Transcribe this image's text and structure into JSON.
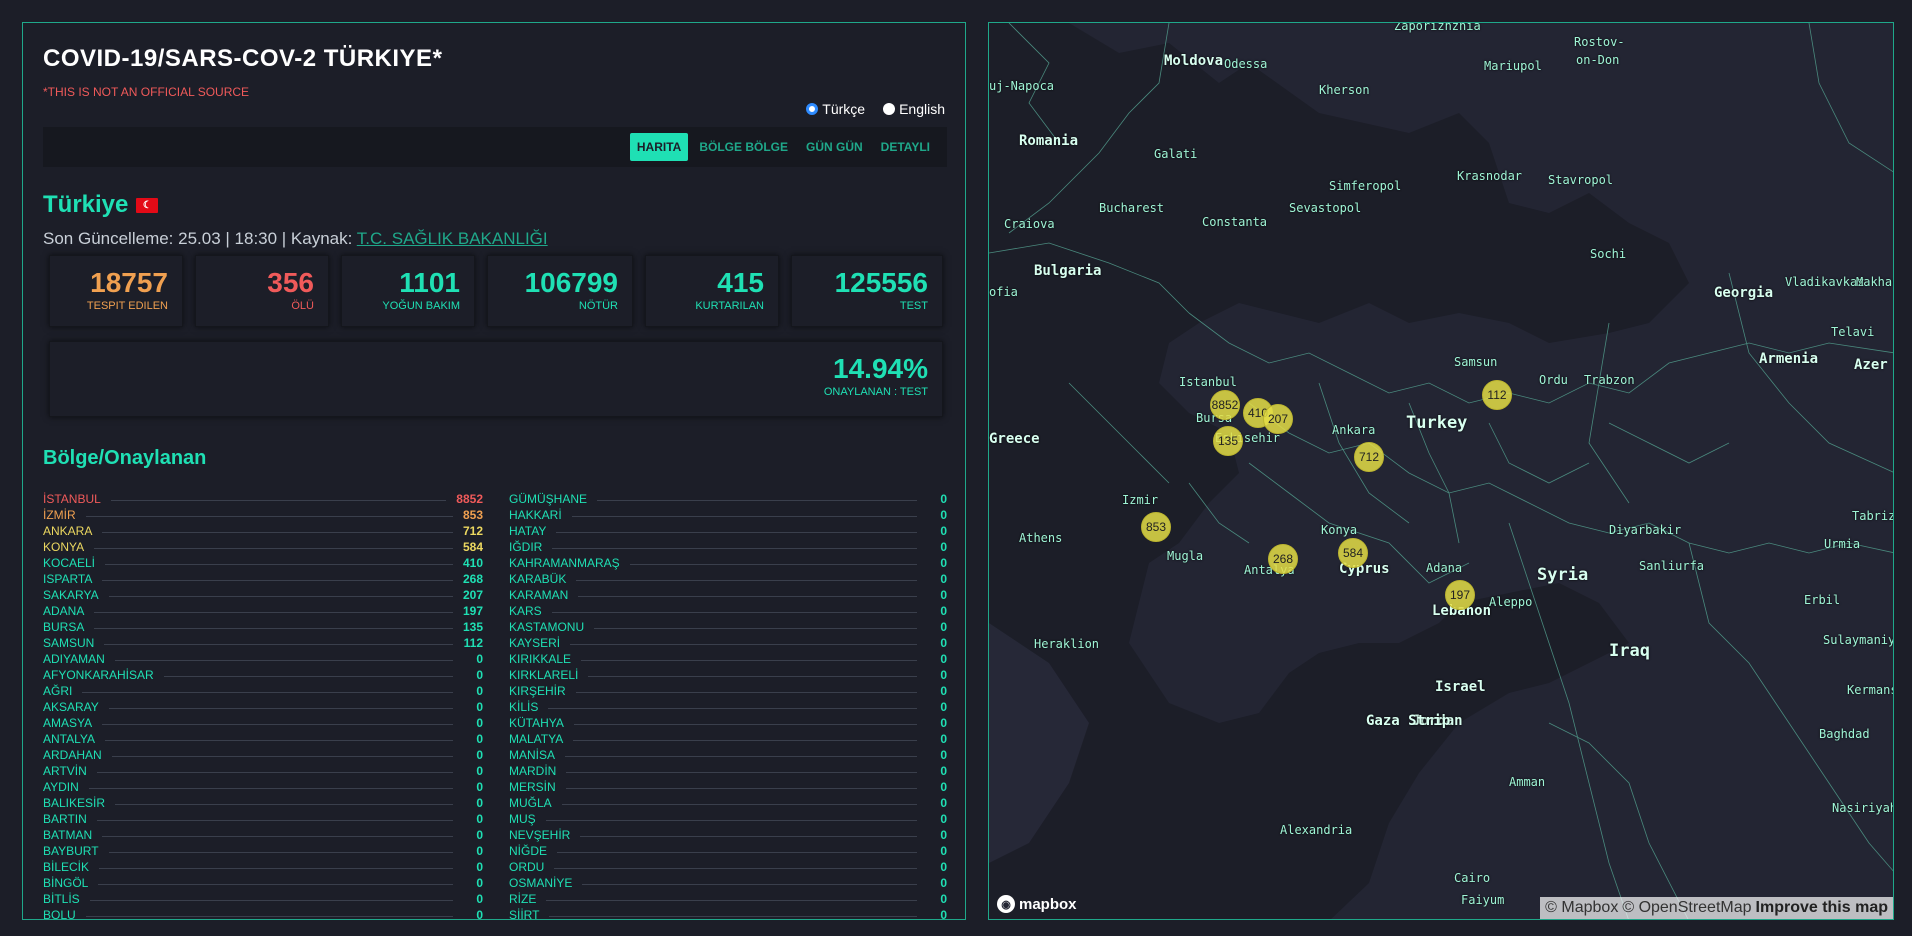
{
  "header": {
    "title": "COVID-19/SARS-COV-2 TÜRKIYE*",
    "disclaimer": "*THIS IS NOT AN OFFICIAL SOURCE"
  },
  "language": {
    "options": [
      {
        "label": "Türkçe",
        "checked": true
      },
      {
        "label": "English",
        "checked": false
      }
    ]
  },
  "tabs": [
    {
      "label": "HARITA",
      "active": true
    },
    {
      "label": "BÖLGE BÖLGE",
      "active": false
    },
    {
      "label": "GÜN GÜN",
      "active": false
    },
    {
      "label": "DETAYLI",
      "active": false
    }
  ],
  "country": {
    "name": "Türkiye",
    "flag_icon": "turkey-flag-icon",
    "updated_prefix": "Son Güncelleme: 25.03 | 18:30 | Kaynak: ",
    "source_link": "T.C. SAĞLIK BAKANLIĞI"
  },
  "stats": [
    {
      "value": "18757",
      "label": "TESPIT EDILEN",
      "color": "#f0a050"
    },
    {
      "value": "356",
      "label": "ÖLÜ",
      "color": "#f05a5a"
    },
    {
      "value": "1101",
      "label": "YOĞUN BAKIM",
      "color": "#1fe0b4"
    },
    {
      "value": "106799",
      "label": "NÖTÜR",
      "color": "#1fe0b4"
    },
    {
      "value": "415",
      "label": "KURTARILAN",
      "color": "#1fe0b4"
    },
    {
      "value": "125556",
      "label": "TEST",
      "color": "#1fe0b4"
    }
  ],
  "ratio": {
    "value": "14.94%",
    "label": "ONAYLANAN : TEST"
  },
  "regions": {
    "title": "Bölge/Onaylanan",
    "left": [
      {
        "name": "İSTANBUL",
        "value": "8852",
        "color": "#f05a5a"
      },
      {
        "name": "İZMİR",
        "value": "853",
        "color": "#f0a050"
      },
      {
        "name": "ANKARA",
        "value": "712",
        "color": "#ecd860"
      },
      {
        "name": "KONYA",
        "value": "584",
        "color": "#ecd860"
      },
      {
        "name": "KOCAELİ",
        "value": "410",
        "color": "#1fe0b4"
      },
      {
        "name": "ISPARTA",
        "value": "268",
        "color": "#1fe0b4"
      },
      {
        "name": "SAKARYA",
        "value": "207",
        "color": "#1fe0b4"
      },
      {
        "name": "ADANA",
        "value": "197",
        "color": "#1fe0b4"
      },
      {
        "name": "BURSA",
        "value": "135",
        "color": "#1fe0b4"
      },
      {
        "name": "SAMSUN",
        "value": "112",
        "color": "#1fe0b4"
      },
      {
        "name": "ADIYAMAN",
        "value": "0",
        "color": "#1fe0b4"
      },
      {
        "name": "AFYONKARAHİSAR",
        "value": "0",
        "color": "#1fe0b4"
      },
      {
        "name": "AĞRI",
        "value": "0",
        "color": "#1fe0b4"
      },
      {
        "name": "AKSARAY",
        "value": "0",
        "color": "#1fe0b4"
      },
      {
        "name": "AMASYA",
        "value": "0",
        "color": "#1fe0b4"
      },
      {
        "name": "ANTALYA",
        "value": "0",
        "color": "#1fe0b4"
      },
      {
        "name": "ARDAHAN",
        "value": "0",
        "color": "#1fe0b4"
      },
      {
        "name": "ARTVİN",
        "value": "0",
        "color": "#1fe0b4"
      },
      {
        "name": "AYDIN",
        "value": "0",
        "color": "#1fe0b4"
      },
      {
        "name": "BALIKESİR",
        "value": "0",
        "color": "#1fe0b4"
      },
      {
        "name": "BARTIN",
        "value": "0",
        "color": "#1fe0b4"
      },
      {
        "name": "BATMAN",
        "value": "0",
        "color": "#1fe0b4"
      },
      {
        "name": "BAYBURT",
        "value": "0",
        "color": "#1fe0b4"
      },
      {
        "name": "BİLECİK",
        "value": "0",
        "color": "#1fe0b4"
      },
      {
        "name": "BİNGÖL",
        "value": "0",
        "color": "#1fe0b4"
      },
      {
        "name": "BİTLİS",
        "value": "0",
        "color": "#1fe0b4"
      },
      {
        "name": "BOLU",
        "value": "0",
        "color": "#1fe0b4"
      }
    ],
    "right": [
      {
        "name": "GÜMÜŞHANE",
        "value": "0",
        "color": "#1fe0b4"
      },
      {
        "name": "HAKKARİ",
        "value": "0",
        "color": "#1fe0b4"
      },
      {
        "name": "HATAY",
        "value": "0",
        "color": "#1fe0b4"
      },
      {
        "name": "IĞDIR",
        "value": "0",
        "color": "#1fe0b4"
      },
      {
        "name": "KAHRAMANMARAŞ",
        "value": "0",
        "color": "#1fe0b4"
      },
      {
        "name": "KARABÜK",
        "value": "0",
        "color": "#1fe0b4"
      },
      {
        "name": "KARAMAN",
        "value": "0",
        "color": "#1fe0b4"
      },
      {
        "name": "KARS",
        "value": "0",
        "color": "#1fe0b4"
      },
      {
        "name": "KASTAMONU",
        "value": "0",
        "color": "#1fe0b4"
      },
      {
        "name": "KAYSERİ",
        "value": "0",
        "color": "#1fe0b4"
      },
      {
        "name": "KIRIKKALE",
        "value": "0",
        "color": "#1fe0b4"
      },
      {
        "name": "KIRKLARELİ",
        "value": "0",
        "color": "#1fe0b4"
      },
      {
        "name": "KIRŞEHİR",
        "value": "0",
        "color": "#1fe0b4"
      },
      {
        "name": "KİLİS",
        "value": "0",
        "color": "#1fe0b4"
      },
      {
        "name": "KÜTAHYA",
        "value": "0",
        "color": "#1fe0b4"
      },
      {
        "name": "MALATYA",
        "value": "0",
        "color": "#1fe0b4"
      },
      {
        "name": "MANİSA",
        "value": "0",
        "color": "#1fe0b4"
      },
      {
        "name": "MARDİN",
        "value": "0",
        "color": "#1fe0b4"
      },
      {
        "name": "MERSİN",
        "value": "0",
        "color": "#1fe0b4"
      },
      {
        "name": "MUĞLA",
        "value": "0",
        "color": "#1fe0b4"
      },
      {
        "name": "MUŞ",
        "value": "0",
        "color": "#1fe0b4"
      },
      {
        "name": "NEVŞEHİR",
        "value": "0",
        "color": "#1fe0b4"
      },
      {
        "name": "NİĞDE",
        "value": "0",
        "color": "#1fe0b4"
      },
      {
        "name": "ORDU",
        "value": "0",
        "color": "#1fe0b4"
      },
      {
        "name": "OSMANİYE",
        "value": "0",
        "color": "#1fe0b4"
      },
      {
        "name": "RİZE",
        "value": "0",
        "color": "#1fe0b4"
      },
      {
        "name": "SİİRT",
        "value": "0",
        "color": "#1fe0b4"
      }
    ]
  },
  "map": {
    "labels": [
      {
        "text": "Moldova",
        "cls": "country-md"
      },
      {
        "text": "Romania",
        "cls": "country-md"
      },
      {
        "text": "Bulgaria",
        "cls": "country-md"
      },
      {
        "text": "Greece",
        "cls": "country-md"
      },
      {
        "text": "Turkey",
        "cls": "country-lg"
      },
      {
        "text": "Georgia",
        "cls": "country-md"
      },
      {
        "text": "Armenia",
        "cls": "country-md"
      },
      {
        "text": "Azer",
        "cls": "country-md"
      },
      {
        "text": "Syria",
        "cls": "country-lg"
      },
      {
        "text": "Iraq",
        "cls": "country-lg"
      },
      {
        "text": "Cyprus",
        "cls": "country-md"
      },
      {
        "text": "Lebanon",
        "cls": "country-md"
      },
      {
        "text": "Israel",
        "cls": "country-md"
      },
      {
        "text": "Jordan",
        "cls": "country-md"
      },
      {
        "text": "Gaza Strip",
        "cls": "country-md"
      },
      {
        "text": "Zaporizhzhia",
        "cls": "city"
      },
      {
        "text": "Rostov-",
        "cls": "city"
      },
      {
        "text": "on-Don",
        "cls": "city"
      },
      {
        "text": "Mariupol",
        "cls": "city"
      },
      {
        "text": "Odessa",
        "cls": "city"
      },
      {
        "text": "Kherson",
        "cls": "city"
      },
      {
        "text": "uj-Napoca",
        "cls": "city"
      },
      {
        "text": "Galati",
        "cls": "city"
      },
      {
        "text": "Simferopol",
        "cls": "city"
      },
      {
        "text": "Krasnodar",
        "cls": "city"
      },
      {
        "text": "Stavropol",
        "cls": "city"
      },
      {
        "text": "Sevastopol",
        "cls": "city"
      },
      {
        "text": "Bucharest",
        "cls": "city"
      },
      {
        "text": "Craiova",
        "cls": "city"
      },
      {
        "text": "Constanta",
        "cls": "city"
      },
      {
        "text": "Sochi",
        "cls": "city"
      },
      {
        "text": "ofia",
        "cls": "city"
      },
      {
        "text": "Vladikavkaz",
        "cls": "city"
      },
      {
        "text": "Makhac",
        "cls": "city"
      },
      {
        "text": "Telavi",
        "cls": "city"
      },
      {
        "text": "Samsun",
        "cls": "city"
      },
      {
        "text": "Ordu",
        "cls": "city"
      },
      {
        "text": "Trabzon",
        "cls": "city"
      },
      {
        "text": "Istanbul",
        "cls": "city"
      },
      {
        "text": "Bursa",
        "cls": "city"
      },
      {
        "text": "Eskisehir",
        "cls": "city"
      },
      {
        "text": "Ankara",
        "cls": "city"
      },
      {
        "text": "Izmir",
        "cls": "city"
      },
      {
        "text": "Athens",
        "cls": "city"
      },
      {
        "text": "Konya",
        "cls": "city"
      },
      {
        "text": "Mugla",
        "cls": "city"
      },
      {
        "text": "Antalya",
        "cls": "city"
      },
      {
        "text": "Adana",
        "cls": "city"
      },
      {
        "text": "Aleppo",
        "cls": "city"
      },
      {
        "text": "Diyarbakir",
        "cls": "city"
      },
      {
        "text": "Sanliurfa",
        "cls": "city"
      },
      {
        "text": "Tabriz",
        "cls": "city"
      },
      {
        "text": "Urmia",
        "cls": "city"
      },
      {
        "text": "Erbil",
        "cls": "city"
      },
      {
        "text": "Sulaymaniyah",
        "cls": "city"
      },
      {
        "text": "Kermans",
        "cls": "city"
      },
      {
        "text": "Baghdad",
        "cls": "city"
      },
      {
        "text": "Nasiriyah",
        "cls": "city"
      },
      {
        "text": "Heraklion",
        "cls": "city"
      },
      {
        "text": "Amman",
        "cls": "city"
      },
      {
        "text": "Alexandria",
        "cls": "city"
      },
      {
        "text": "Cairo",
        "cls": "city"
      },
      {
        "text": "Faiyum",
        "cls": "city"
      }
    ],
    "clusters": [
      {
        "value": "8852"
      },
      {
        "value": "410"
      },
      {
        "value": "207"
      },
      {
        "value": "135"
      },
      {
        "value": "712"
      },
      {
        "value": "112"
      },
      {
        "value": "853"
      },
      {
        "value": "268"
      },
      {
        "value": "584"
      },
      {
        "value": "197"
      }
    ],
    "logo": "mapbox",
    "logo_icon": "mapbox-icon",
    "attribution": {
      "mapbox": "© Mapbox",
      "osm": "© OpenStreetMap",
      "improve": "Improve this map"
    }
  }
}
